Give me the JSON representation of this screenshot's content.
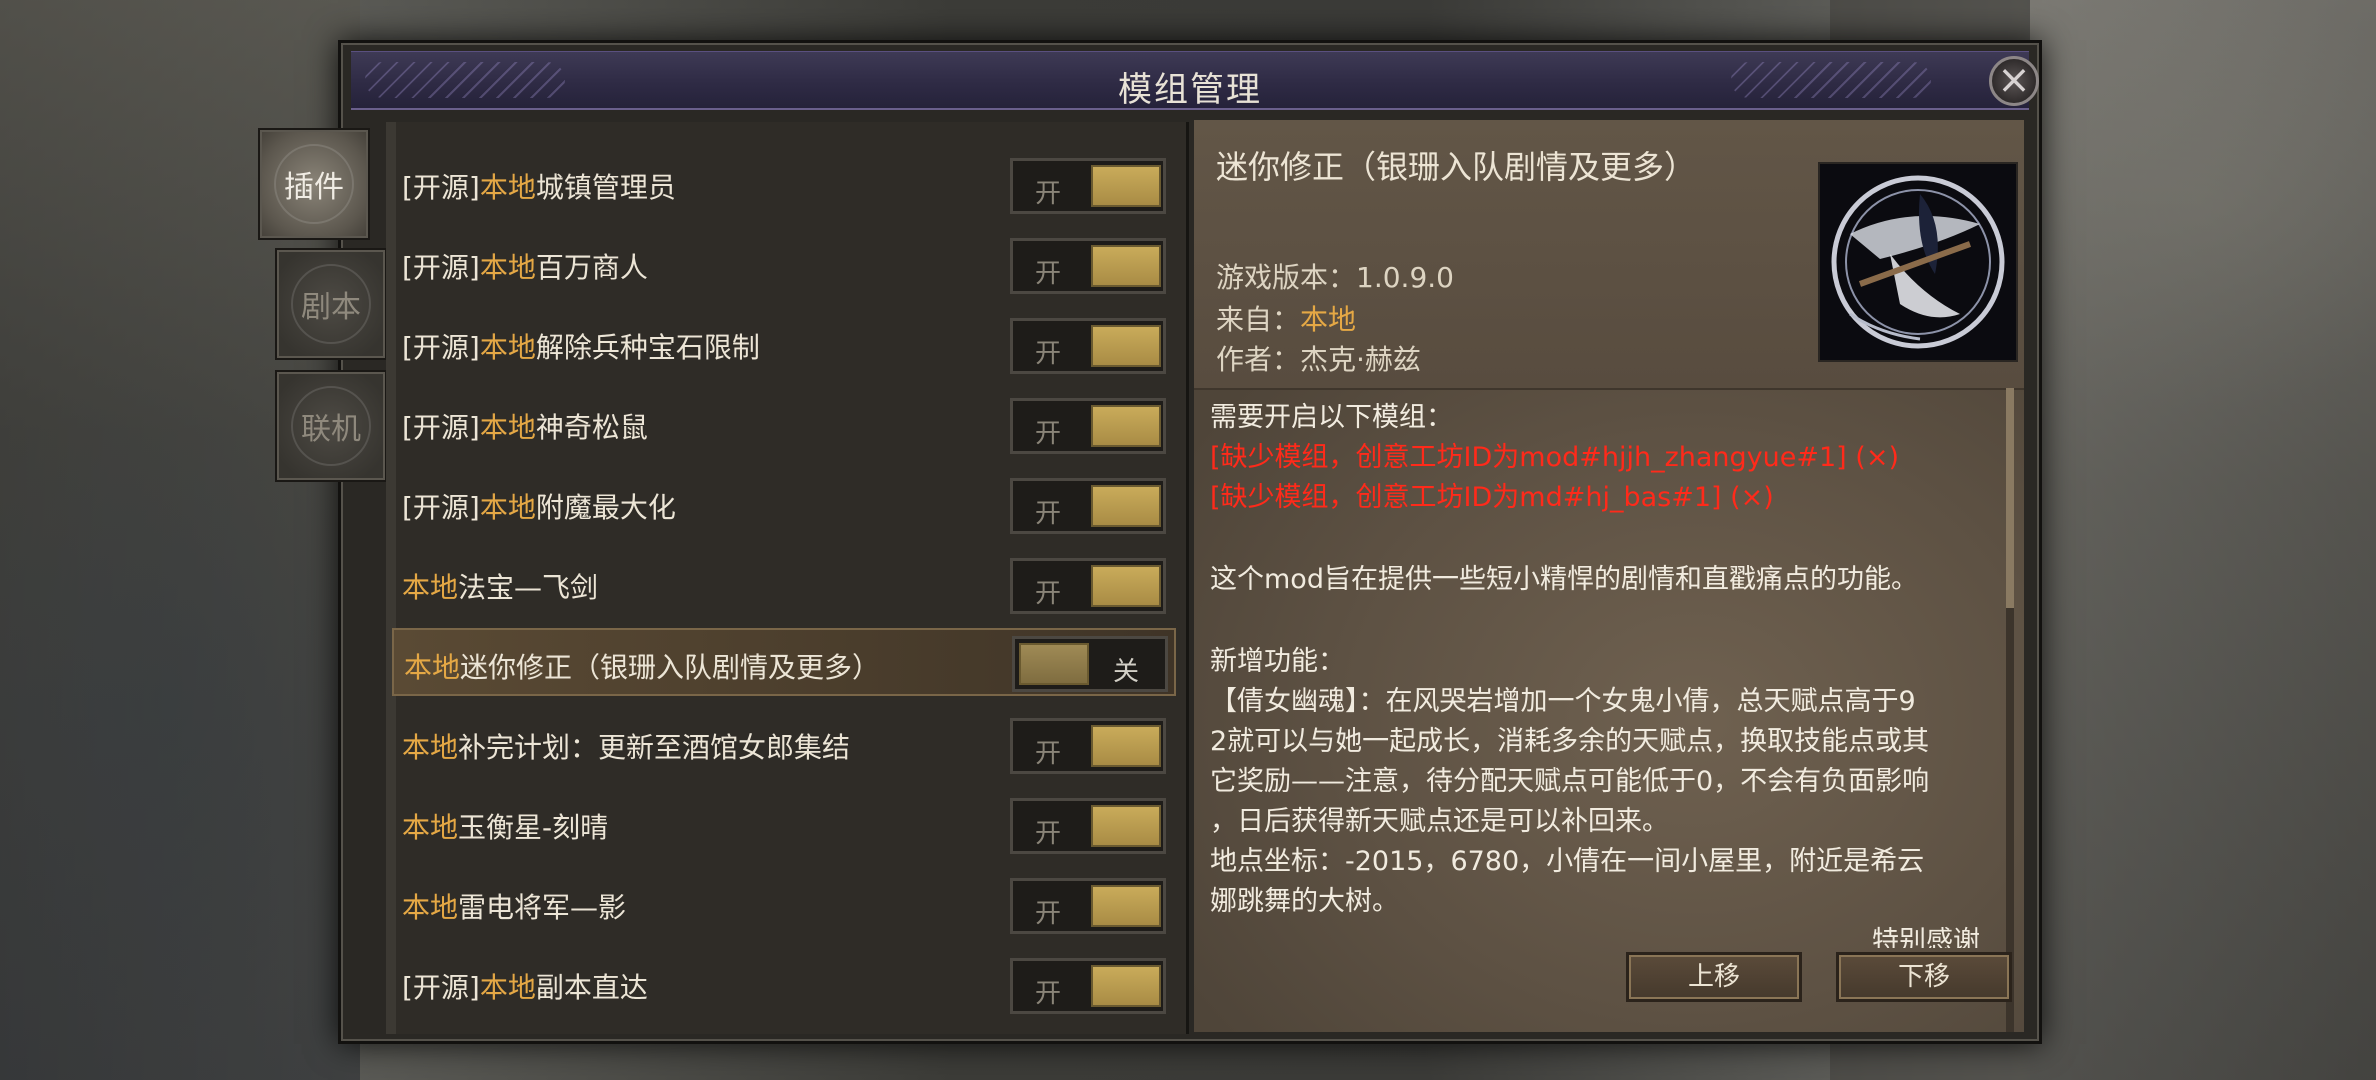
{
  "window": {
    "title": "模组管理",
    "close_label": "×"
  },
  "side_tabs": [
    {
      "label": "插件",
      "active": true
    },
    {
      "label": "剧本",
      "active": false
    },
    {
      "label": "联机",
      "active": false
    }
  ],
  "mods": [
    {
      "prefix": "[开源]",
      "source": "本地",
      "name": "城镇管理员",
      "toggle": "开"
    },
    {
      "prefix": "[开源]",
      "source": "本地",
      "name": "百万商人",
      "toggle": "开"
    },
    {
      "prefix": "[开源]",
      "source": "本地",
      "name": "解除兵种宝石限制",
      "toggle": "开"
    },
    {
      "prefix": "[开源]",
      "source": "本地",
      "name": "神奇松鼠",
      "toggle": "开"
    },
    {
      "prefix": "[开源]",
      "source": "本地",
      "name": "附魔最大化",
      "toggle": "开"
    },
    {
      "prefix": "",
      "source": "本地",
      "name": "法宝—飞剑",
      "toggle": "开"
    },
    {
      "prefix": "",
      "source": "本地",
      "name": "迷你修正（银珊入队剧情及更多）",
      "toggle": "关"
    },
    {
      "prefix": "",
      "source": "本地",
      "name": "补完计划：更新至酒馆女郎集结",
      "toggle": "开"
    },
    {
      "prefix": "",
      "source": "本地",
      "name": "玉衡星-刻晴",
      "toggle": "开"
    },
    {
      "prefix": "",
      "source": "本地",
      "name": "雷电将军—影",
      "toggle": "开"
    },
    {
      "prefix": "[开源]",
      "source": "本地",
      "name": "副本直达",
      "toggle": "开"
    }
  ],
  "detail": {
    "title": "迷你修正（银珊入队剧情及更多）",
    "version_label": "游戏版本：",
    "version": "1.0.9.0",
    "from_label": "来自：",
    "from": "本地",
    "author_label": "作者：",
    "author": "杰克·赫兹",
    "requires": "需要开启以下模组：",
    "missing": [
      "[缺少模组，创意工坊ID为mod#hjjh_zhangyue#1] (×)",
      "[缺少模组，创意工坊ID为md#hj_bas#1] (×)"
    ],
    "summary": "这个mod旨在提供一些短小精悍的剧情和直戳痛点的功能。",
    "new_features": "新增功能：",
    "body_lines": [
      "【倩女幽魂】：在风哭岩增加一个女鬼小倩，总天赋点高于9",
      "2就可以与她一起成长，消耗多余的天赋点，换取技能点或其",
      "它奖励——注意，待分配天赋点可能低于0，不会有负面影响",
      "，日后获得新天赋点还是可以补回来。",
      "地点坐标：-2015，6780，小倩在一间小屋里，附近是希云",
      "娜跳舞的大树。"
    ],
    "cut_line": "特别感谢"
  },
  "buttons": {
    "move_up": "上移",
    "move_down": "下移"
  },
  "colors": {
    "accent_orange": "#e5a845",
    "missing_red": "#ff2a1a",
    "toggle_gold": "#c9ab5a"
  }
}
